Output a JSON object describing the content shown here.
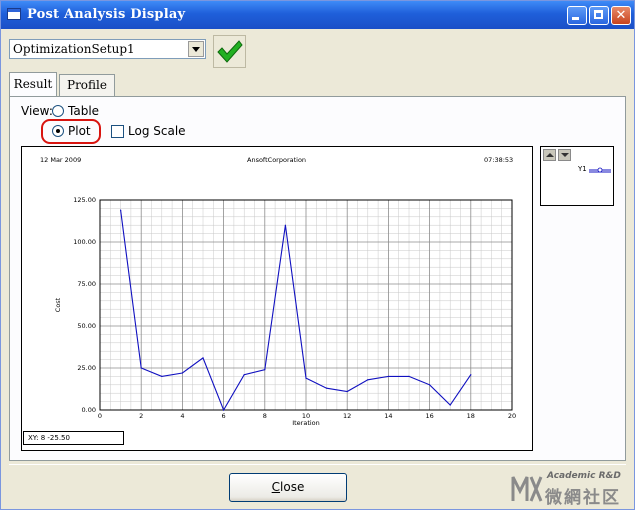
{
  "window": {
    "title": "Post Analysis Display"
  },
  "toolbar": {
    "setup_value": "OptimizationSetup1"
  },
  "tabs": [
    {
      "label": "Result",
      "active": true
    },
    {
      "label": "Profile",
      "active": false
    }
  ],
  "view": {
    "label": "View:",
    "table_label": "Table",
    "plot_label": "Plot",
    "selected": "Plot",
    "log_scale_label": "Log Scale",
    "log_scale_checked": false
  },
  "plot": {
    "header_date": "12 Mar 2009",
    "header_company": "AnsoftCorporation",
    "header_time": "07:38:53",
    "xy_readout": "XY: 8 -25.50"
  },
  "legend": {
    "entries": [
      "Y1"
    ]
  },
  "footer": {
    "close_underline": "C",
    "close_rest": "lose"
  },
  "watermark": {
    "line1": "Academic R&D",
    "line2": "微網社区"
  },
  "colors": {
    "titlebar": "#1F5FDA",
    "series": "#1010C0",
    "highlight": "#D8140F",
    "check": "#22B022"
  },
  "chart_data": {
    "type": "line",
    "xlabel": "Iteration",
    "ylabel": "Cost",
    "xlim": [
      0,
      20
    ],
    "ylim": [
      0,
      125
    ],
    "x_ticks": [
      "0",
      "2",
      "4",
      "6",
      "8",
      "10",
      "12",
      "14",
      "16",
      "18",
      "20"
    ],
    "y_ticks": [
      "0.00",
      "25.00",
      "50.00",
      "75.00",
      "100.00",
      "125.00"
    ],
    "grid": true,
    "legend_position": "right",
    "series": [
      {
        "name": "Y1",
        "x": [
          1,
          2,
          3,
          4,
          5,
          6,
          7,
          8,
          9,
          10,
          11,
          12,
          13,
          14,
          15,
          16,
          17,
          18
        ],
        "y": [
          119,
          25,
          20,
          22,
          31,
          0,
          21,
          24,
          110,
          19,
          13,
          11,
          18,
          20,
          20,
          15,
          3,
          21
        ]
      }
    ]
  }
}
